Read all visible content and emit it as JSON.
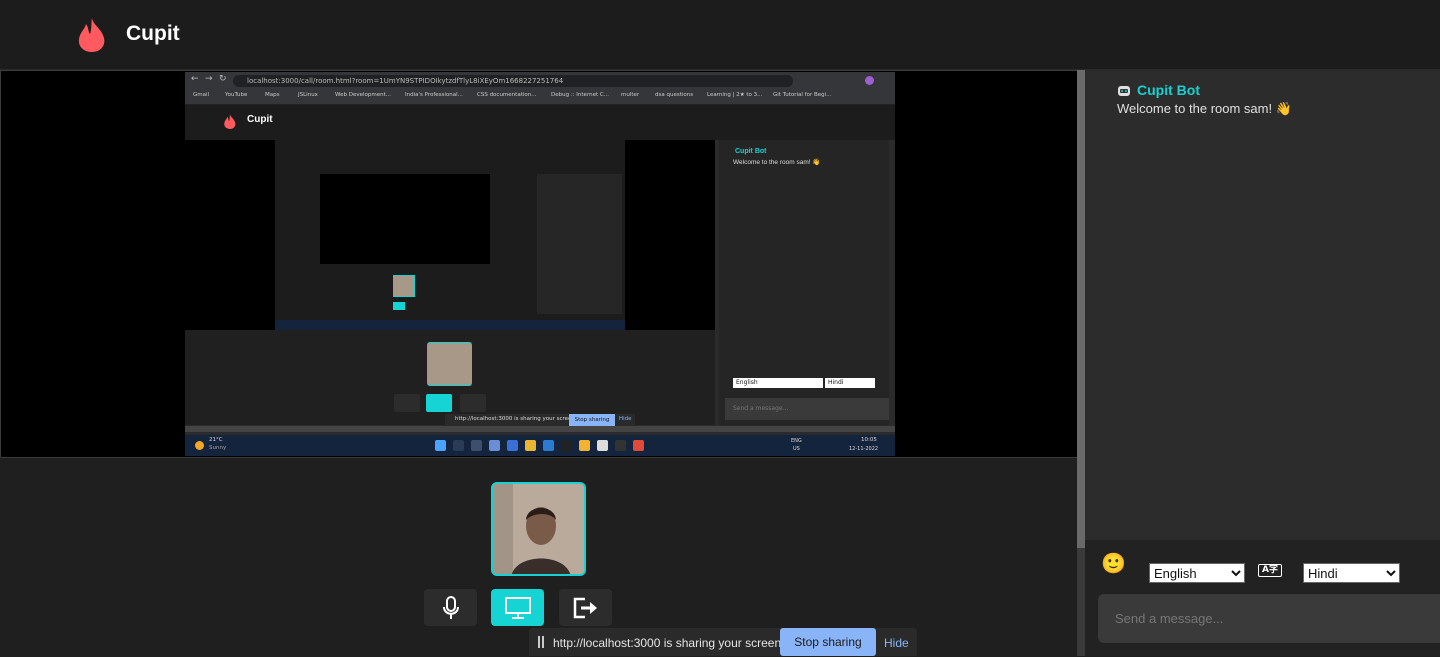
{
  "header": {
    "brand": "Cupit"
  },
  "shared_screen": {
    "url": "localhost:3000/call/room.html?room=1UmYN9STPIDOIkytzdfTlyL8iXEyOm1668227251764",
    "bookmarks": [
      "Gmail",
      "YouTube",
      "Maps",
      "JSLinux",
      "Web Development...",
      "India's Professional...",
      "CSS documentation...",
      "Debug :: Internet C...",
      "multer",
      "dsa questions",
      "Learning | 2★ to 3...",
      "Git Tutorial for Begi..."
    ],
    "inner_brand": "Cupit",
    "inner_chat": {
      "bot_name": "Cupit Bot",
      "bot_message": "Welcome to the room sam! 👋",
      "from_lang": "English",
      "to_lang": "Hindi",
      "placeholder": "Send a message..."
    },
    "inner_share_text": "http://localhost:3000 is sharing your screen.",
    "inner_stop": "Stop sharing",
    "inner_hide": "Hide",
    "weather_temp": "21°C",
    "weather_desc": "Sunny",
    "lang_top": "ENG",
    "lang_bottom": "US",
    "time": "10:05",
    "date": "12-11-2022"
  },
  "controls": {
    "mic": "mic-icon",
    "screen": "monitor-icon",
    "leave": "exit-icon"
  },
  "share_bar": {
    "text": "http://localhost:3000 is sharing your screen.",
    "stop_label": "Stop sharing",
    "hide_label": "Hide"
  },
  "chat": {
    "bot_name": "Cupit Bot",
    "bot_message": "Welcome to the room sam! 👋",
    "from_lang": "English",
    "to_lang": "Hindi",
    "translate_glyph": "A字",
    "emoji": "🙂",
    "placeholder": "Send a message..."
  },
  "colors": {
    "accent": "#1ad1d1",
    "brand_flame": "#ff5a5f",
    "stop_button": "#8ab4f8"
  }
}
